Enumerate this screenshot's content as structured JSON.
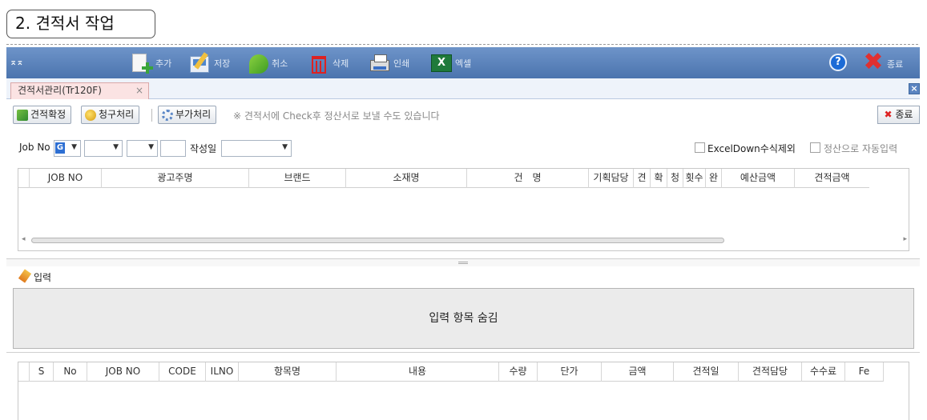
{
  "section_title": "2. 견적서 작업",
  "toolbar": {
    "collapse_icon_text": "⌅⌅",
    "buttons": [
      {
        "id": "add",
        "label": "추가",
        "icon": "add-document-icon"
      },
      {
        "id": "save",
        "label": "저장",
        "icon": "save-icon"
      },
      {
        "id": "cancel",
        "label": "취소",
        "icon": "undo-arrow-icon"
      },
      {
        "id": "delete",
        "label": "삭제",
        "icon": "trash-icon"
      },
      {
        "id": "print",
        "label": "인쇄",
        "icon": "printer-icon"
      },
      {
        "id": "excel",
        "label": "엑셀",
        "icon": "excel-icon"
      }
    ],
    "help_glyph": "?",
    "exit_glyph": "✖",
    "exit_label": "종료",
    "colors": {
      "bar_top": "#6e94c9",
      "bar_bottom": "#4b74ae",
      "exit": "#e03030",
      "help": "#1c6bd6"
    }
  },
  "tabs": [
    {
      "label": "견적서관리(Tr120F)",
      "close": "×"
    }
  ],
  "tab_close_all": "×",
  "subbar": {
    "confirm_label": "견적확정",
    "claim_label": "청구처리",
    "extra_label": "부가처리",
    "hint": "※ 견적서에 Check후 정산서로 보낼 수도 있습니다",
    "end_x": "✖",
    "end_label": "종료"
  },
  "filters": {
    "jobno_label": "Job No",
    "jobno_badge": "G",
    "date_label": "작성일",
    "excel_down_label": "ExcelDown수식제외",
    "auto_settle_label": "정산으로 자동입력",
    "combo_arrow": "▼"
  },
  "grid_top": {
    "columns": [
      "",
      "JOB NO",
      "광고주명",
      "브랜드",
      "소재명",
      "건　명",
      "기획담당",
      "견",
      "확",
      "청",
      "횟수",
      "완",
      "예산금액",
      "견적금액"
    ]
  },
  "scroll": {
    "left": "◂",
    "right": "▸"
  },
  "input_section": {
    "title": "입력",
    "hidden_text": "입력 항목 숨김"
  },
  "grid_bottom": {
    "columns": [
      "",
      "S",
      "No",
      "JOB NO",
      "CODE",
      "ILNO",
      "항목명",
      "내용",
      "수량",
      "단가",
      "금액",
      "견적일",
      "견적담당",
      "수수료",
      "Fe"
    ]
  }
}
